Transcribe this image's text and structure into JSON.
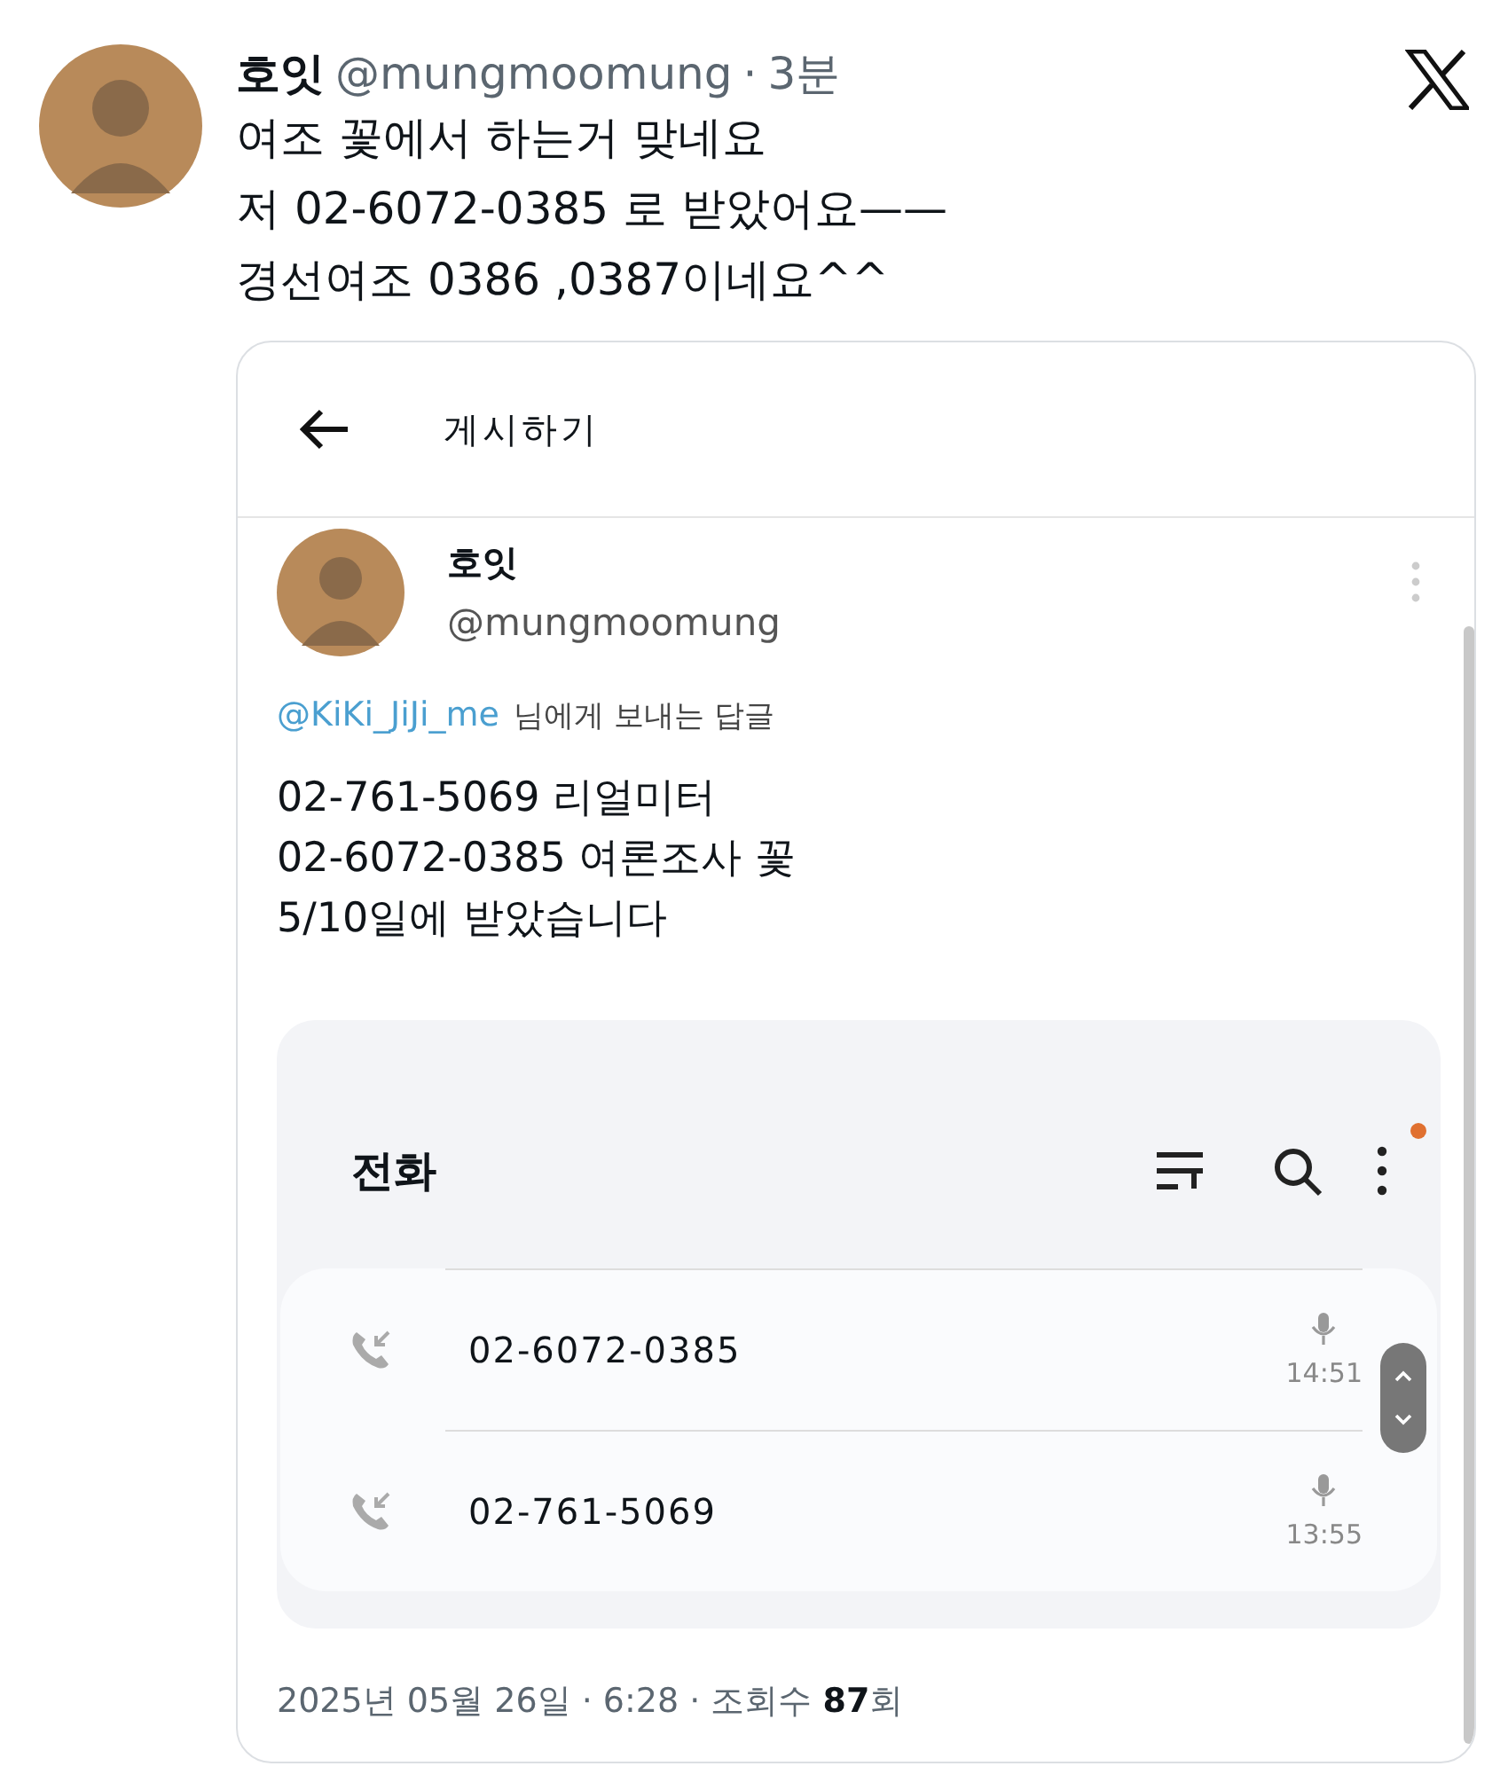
{
  "post": {
    "display_name": "호잇",
    "handle": "@mungmoomung",
    "separator": "·",
    "time": "3분",
    "lines": [
      "여조 꽃에서 하는거 맞네요",
      "저 02-6072-0385 로 받았어요——",
      "경선여조 0386 ,0387이네요^^"
    ]
  },
  "embedded": {
    "header_title": "게시하기",
    "display_name": "호잇",
    "handle": "@mungmoomung",
    "reply_mention": "@KiKi_JiJi_me",
    "reply_text": "님에게 보내는 답글",
    "lines": [
      "02-761-5069  리얼미터",
      "02-6072-0385 여론조사 꽃",
      "5/10일에 받았습니다"
    ],
    "phone_app": {
      "title": "전화",
      "calls": [
        {
          "number": "02-6072-0385",
          "time": "14:51"
        },
        {
          "number": "02-761-5069",
          "time": "13:55"
        }
      ]
    },
    "footer": "2025년 05월 26일 · 6:28 · 조회수 **87**회"
  }
}
